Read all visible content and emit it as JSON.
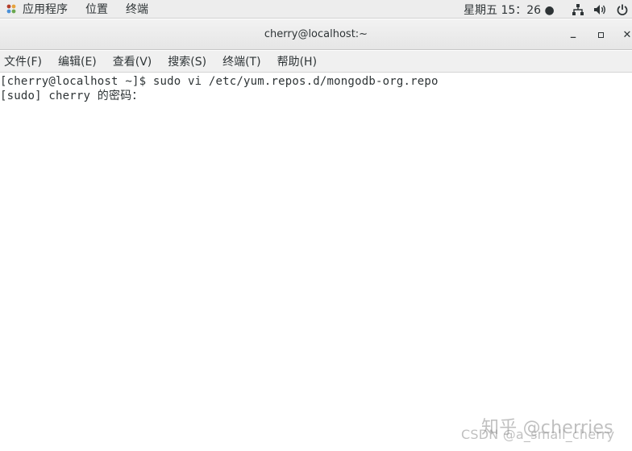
{
  "topbar": {
    "menus": [
      "应用程序",
      "位置",
      "终端"
    ],
    "clock": "星期五 15：26 ●",
    "icons": [
      "network-icon",
      "volume-icon",
      "power-icon"
    ]
  },
  "window": {
    "title": "cherry@localhost:~",
    "controls": {
      "minimize": "_",
      "maximize": "▫",
      "close": "✕"
    }
  },
  "menubar": {
    "items": [
      "文件(F)",
      "编辑(E)",
      "查看(V)",
      "搜索(S)",
      "终端(T)",
      "帮助(H)"
    ]
  },
  "terminal": {
    "lines": [
      "[cherry@localhost ~]$ sudo vi /etc/yum.repos.d/mongodb-org.repo",
      "[sudo] cherry 的密码："
    ]
  },
  "watermarks": {
    "zhihu": "知乎 @cherries",
    "csdn": "CSDN @a_small_cherry"
  }
}
